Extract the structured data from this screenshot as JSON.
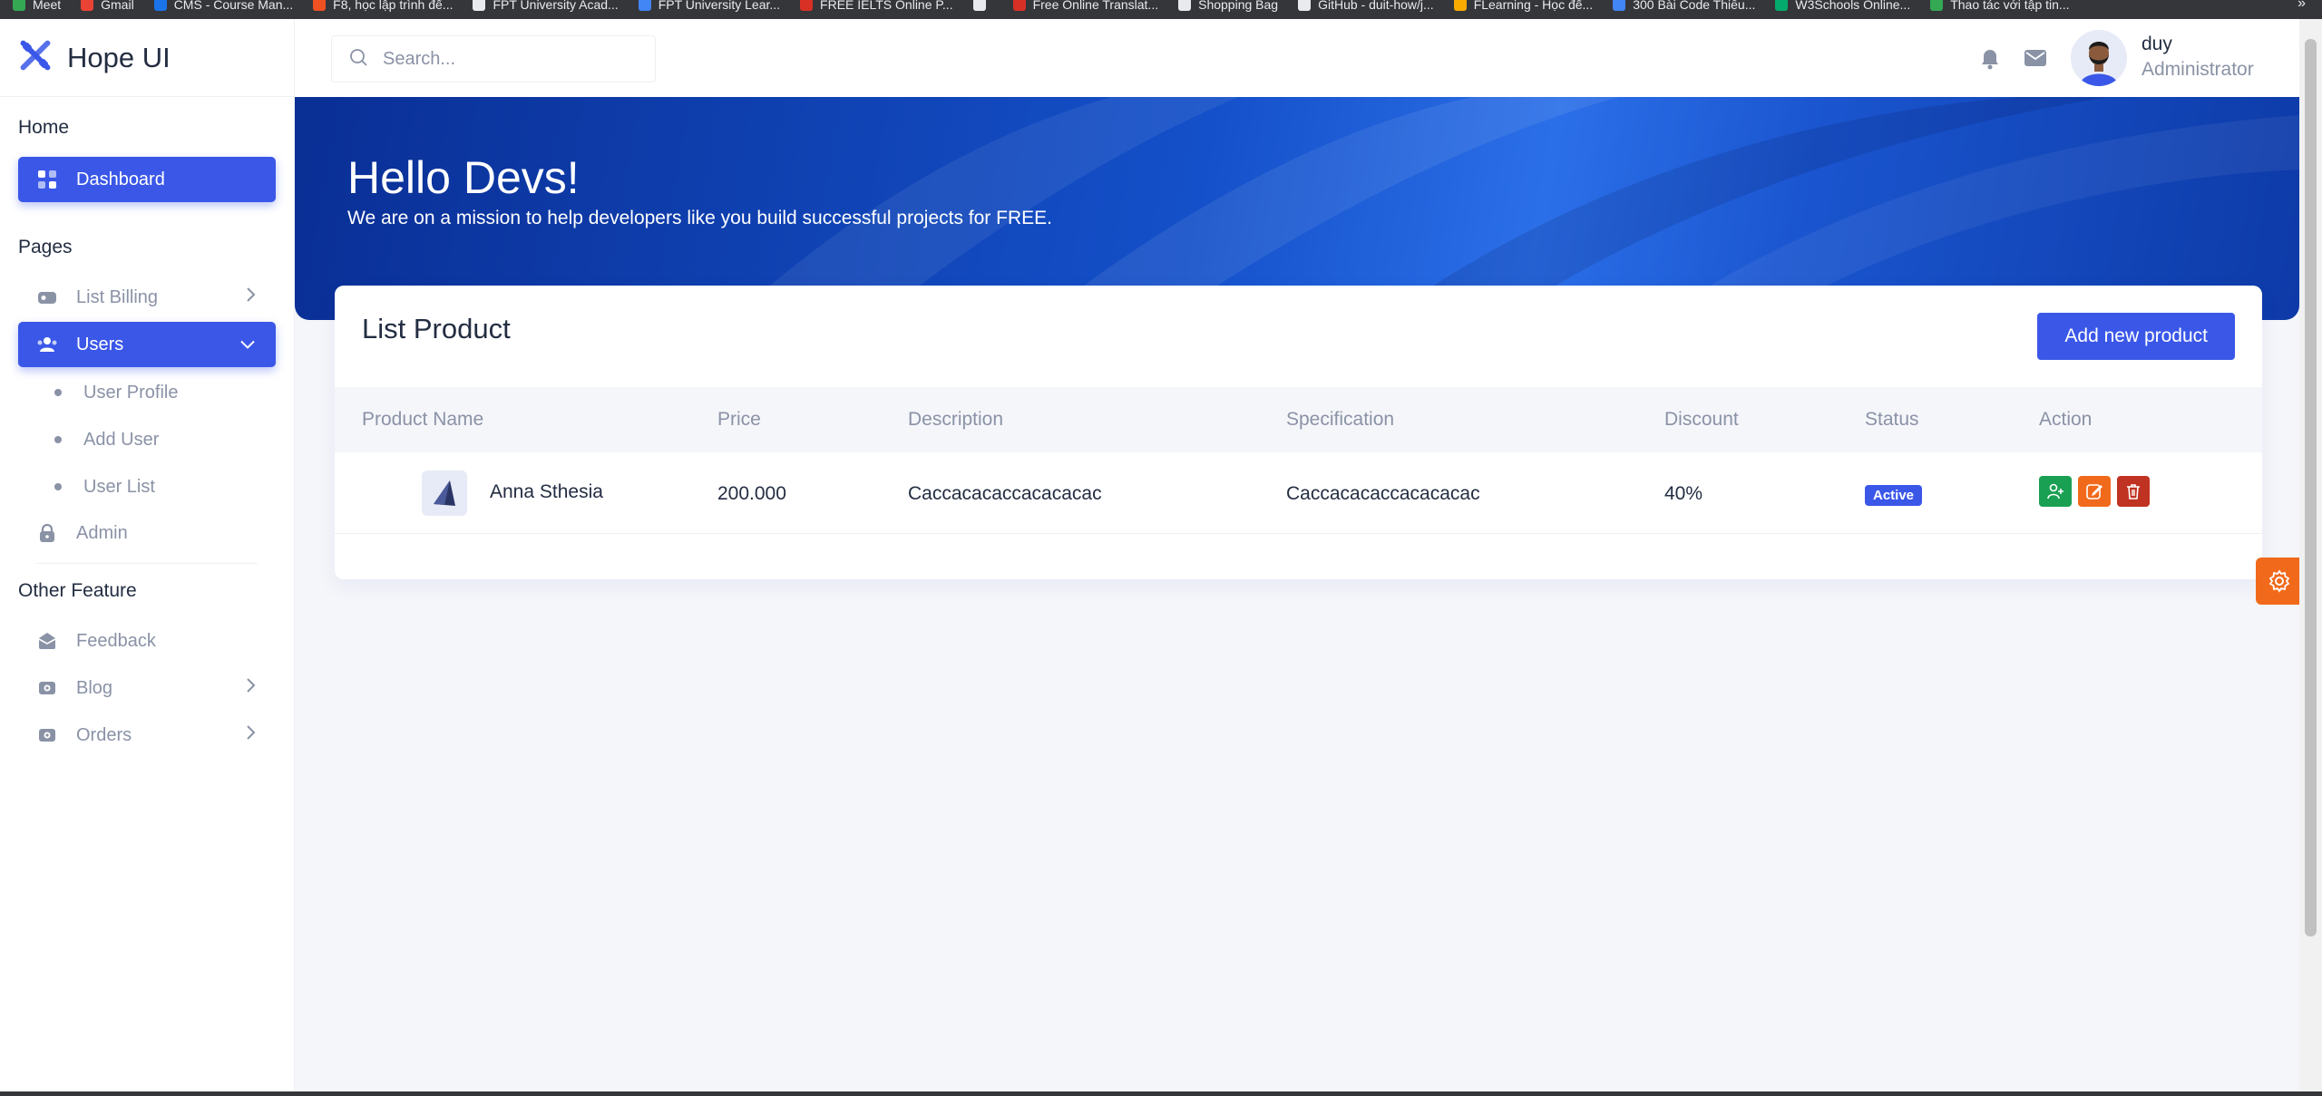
{
  "browser": {
    "bookmarks": [
      {
        "label": "Meet",
        "color": "#34a853"
      },
      {
        "label": "Gmail",
        "color": "#ea4335"
      },
      {
        "label": "CMS - Course Man...",
        "color": "#1a73e8"
      },
      {
        "label": "F8, học lập trình để...",
        "color": "#f05123"
      },
      {
        "label": "FPT University Acad...",
        "color": "#e8eaed"
      },
      {
        "label": "FPT University Lear...",
        "color": "#4285f4"
      },
      {
        "label": "FREE IELTS Online P...",
        "color": "#d93025"
      },
      {
        "label": "",
        "color": "#e8eaed"
      },
      {
        "label": "Free Online Translat...",
        "color": "#d93025"
      },
      {
        "label": "Shopping Bag",
        "color": "#e8eaed"
      },
      {
        "label": "GitHub - duit-how/j...",
        "color": "#e8eaed"
      },
      {
        "label": "FLearning - Học để...",
        "color": "#f9ab00"
      },
      {
        "label": "300 Bài Code Thiếu...",
        "color": "#4285f4"
      },
      {
        "label": "W3Schools Online...",
        "color": "#04aa6d"
      },
      {
        "label": "Thao tác với tập tin...",
        "color": "#34a853"
      }
    ],
    "more": "»"
  },
  "brand": {
    "name": "Hope UI"
  },
  "sidebar": {
    "home_section": "Home",
    "dashboard": "Dashboard",
    "pages_section": "Pages",
    "list_billing": "List Billing",
    "users": "Users",
    "users_sub": [
      "User Profile",
      "Add User",
      "User List"
    ],
    "admin": "Admin",
    "other_section": "Other Feature",
    "feedback": "Feedback",
    "blog": "Blog",
    "orders": "Orders"
  },
  "header": {
    "search_placeholder": "Search...",
    "user_name": "duy",
    "user_role": "Administrator"
  },
  "hero": {
    "title": "Hello Devs!",
    "subtitle": "We are on a mission to help developers like you build successful projects for FREE."
  },
  "card": {
    "title": "List Product",
    "add_button": "Add new product",
    "columns": [
      "Product Name",
      "Price",
      "Description",
      "Specification",
      "Discount",
      "Status",
      "Action"
    ],
    "rows": [
      {
        "name": "Anna Sthesia",
        "price": "200.000",
        "description": "Caccacacaccacacacac",
        "specification": "Caccacacaccacacacac",
        "discount": "40%",
        "status": "Active"
      }
    ]
  },
  "colors": {
    "primary": "#3a57e8",
    "success": "#1aa053",
    "warning": "#f16a1b",
    "danger": "#c03221"
  }
}
